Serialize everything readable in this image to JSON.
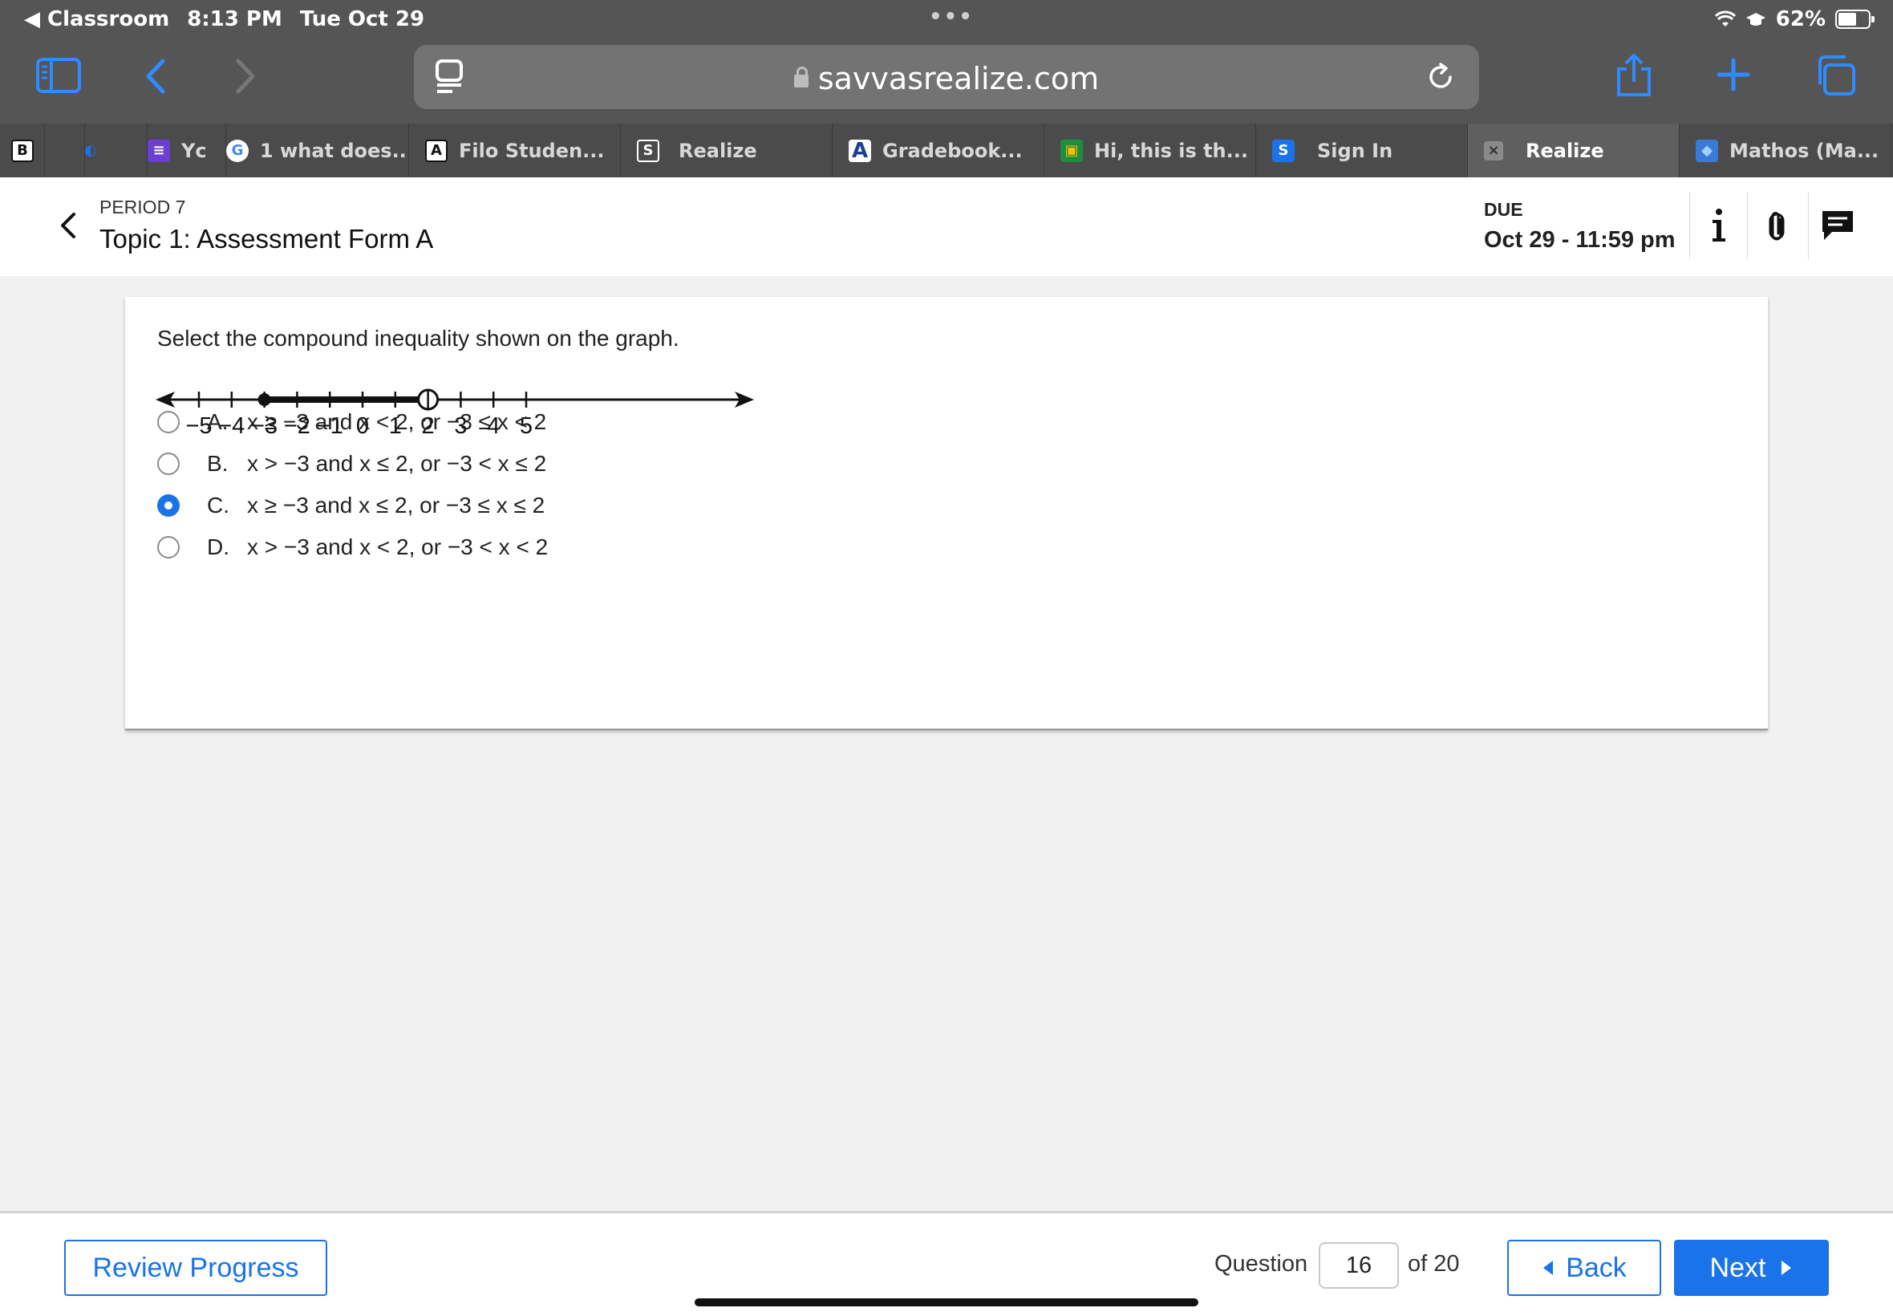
{
  "status": {
    "back_app": "◀ Classroom",
    "time": "8:13 PM",
    "date": "Tue Oct 29",
    "battery": "62%"
  },
  "browser": {
    "url": "savvasrealize.com",
    "tabs": [
      {
        "label": "",
        "favicon_text": "B"
      },
      {
        "label": "",
        "favicon_text": ""
      },
      {
        "label": "Yc",
        "favicon_text": "≡"
      },
      {
        "label": "1 what does...",
        "favicon_text": "G"
      },
      {
        "label": "Filo Studen...",
        "favicon_text": "A"
      },
      {
        "label": "Realize",
        "favicon_text": "S"
      },
      {
        "label": "Gradebook...",
        "favicon_text": "A"
      },
      {
        "label": "Hi, this is th...",
        "favicon_text": "▣"
      },
      {
        "label": "Sign In",
        "favicon_text": "S"
      },
      {
        "label": "Realize",
        "favicon_text": "×"
      },
      {
        "label": "Mathos (Ma...",
        "favicon_text": "◆"
      }
    ]
  },
  "header": {
    "period": "PERIOD 7",
    "title": "Topic 1: Assessment Form A",
    "due_label": "DUE",
    "due_date": "Oct 29 - 11:59 pm"
  },
  "question": {
    "prompt": "Select the compound inequality shown on the graph.",
    "number_line": {
      "ticks": [
        "−5",
        "−4",
        "−3",
        "−2",
        "−1",
        "0",
        "1",
        "2",
        "3",
        "4",
        "5"
      ],
      "closed_point": -3,
      "open_point": 2
    },
    "choices": [
      {
        "letter": "A.",
        "text": "x ≥ −3 and x < 2, or −3 ≤ x < 2",
        "selected": false
      },
      {
        "letter": "B.",
        "text": "x > −3 and x ≤ 2, or −3 < x ≤ 2",
        "selected": false
      },
      {
        "letter": "C.",
        "text": "x ≥ −3 and x ≤ 2, or −3 ≤ x ≤ 2",
        "selected": true
      },
      {
        "letter": "D.",
        "text": "x > −3 and x < 2, or −3 < x < 2",
        "selected": false
      }
    ]
  },
  "footer": {
    "review_label": "Review Progress",
    "question_label": "Question",
    "question_number": "16",
    "of_label": "of 20",
    "back_label": "Back",
    "next_label": "Next"
  },
  "colors": {
    "accent": "#1a73e8",
    "chrome": "#555555",
    "safari_blue": "#2f8cff"
  }
}
